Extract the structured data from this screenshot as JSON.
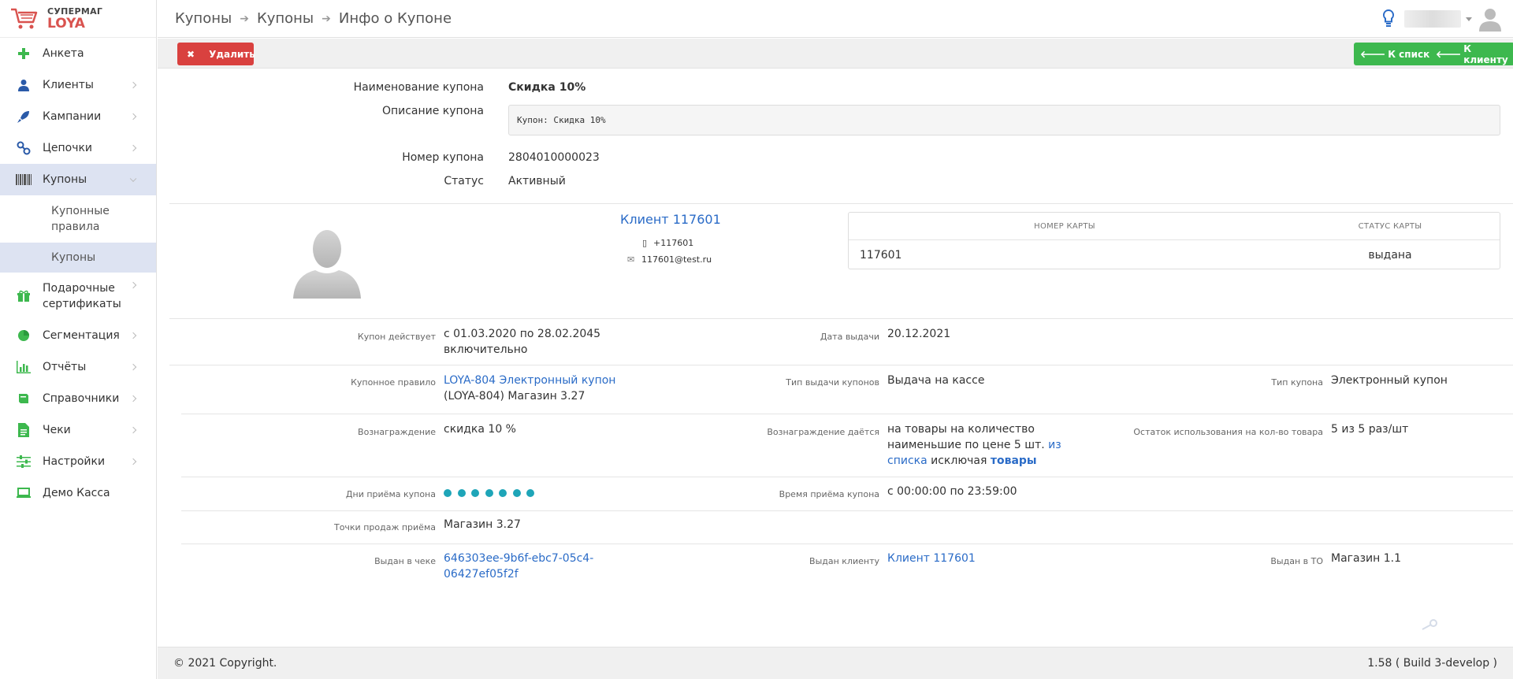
{
  "logo": {
    "line1": "СУПЕРМАГ",
    "line2": "LOYA"
  },
  "sidebar": {
    "items": [
      {
        "label": "Анкета",
        "icon": "plus-icon"
      },
      {
        "label": "Клиенты",
        "icon": "user-icon"
      },
      {
        "label": "Кампании",
        "icon": "rocket-icon"
      },
      {
        "label": "Цепочки",
        "icon": "chain-icon"
      },
      {
        "label": "Купоны",
        "icon": "barcode-icon"
      },
      {
        "label": "Подарочные сертификаты",
        "icon": "gift-icon"
      },
      {
        "label": "Сегментация",
        "icon": "pie-icon"
      },
      {
        "label": "Отчёты",
        "icon": "bar-chart-icon"
      },
      {
        "label": "Справочники",
        "icon": "book-icon"
      },
      {
        "label": "Чеки",
        "icon": "receipt-icon"
      },
      {
        "label": "Настройки",
        "icon": "sliders-icon"
      },
      {
        "label": "Демо Касса",
        "icon": "laptop-icon"
      }
    ],
    "sub": [
      {
        "label": "Купонные правила"
      },
      {
        "label": "Купоны"
      }
    ]
  },
  "breadcrumb": [
    "Купоны",
    "Купоны",
    "Инфо о Купоне"
  ],
  "toolbar": {
    "delete_label": "Удалить",
    "to_list_label": "К списку",
    "to_client_label": "К клиенту"
  },
  "coupon": {
    "name_label": "Наименование купона",
    "name": "Скидка 10%",
    "desc_label": "Описание купона",
    "desc": "Купон: Скидка 10%",
    "number_label": "Номер купона",
    "number": "2804010000023",
    "status_label": "Статус",
    "status": "Активный"
  },
  "client": {
    "name": "Клиент 117601",
    "phone": "+117601",
    "email": "117601@test.ru",
    "table": {
      "headers": [
        "НОМЕР КАРТЫ",
        "СТАТУС КАРТЫ"
      ],
      "rows": [
        [
          "117601",
          "выдана"
        ]
      ]
    }
  },
  "details": {
    "valid_label": "Купон действует",
    "valid_1": "с 01.03.2020 по 28.02.2045",
    "valid_2": "включительно",
    "issued_date_label": "Дата выдачи",
    "issued_date": "20.12.2021",
    "rule_label": "Купонное правило",
    "rule_link": "LOYA-804 Электронный купон",
    "rule_2": "(LOYA-804) Магазин 3.27",
    "issue_type_label": "Тип выдачи купонов",
    "issue_type": "Выдача на кассе",
    "coupon_type_label": "Тип купона",
    "coupon_type": "Электронный купон",
    "reward_label": "Вознаграждение",
    "reward": "скидка 10 %",
    "reward_given_label": "Вознаграждение даётся",
    "reward_given_1": "на товары на количество",
    "reward_given_2": "наименьшие по цене 5 шт.",
    "reward_given_2_link": "из",
    "reward_given_3_link": "списка",
    "reward_given_3": "исключая",
    "reward_given_3_bold": "товары",
    "remaining_label": "Остаток использования на кол-во товара",
    "remaining": "5 из 5 раз/шт",
    "days_label": "Дни приёма купона",
    "days_count": 7,
    "time_label": "Время приёма купона",
    "time": "с 00:00:00 по 23:59:00",
    "points_label": "Точки продаж приёма",
    "points": "Магазин 3.27",
    "receipt_label": "Выдан в чеке",
    "receipt_1": "646303ee-9b6f-ebc7-05c4-",
    "receipt_2": "06427ef05f2f",
    "issued_client_label": "Выдан клиенту",
    "issued_client": "Клиент 117601",
    "issued_to_label": "Выдан в ТО",
    "issued_to": "Магазин 1.1"
  },
  "footer": {
    "copyright": "© 2021 Copyright.",
    "version": "1.58 ( Build 3-develop )"
  },
  "colors": {
    "accent": "#2a6bc7",
    "danger": "#d9413f",
    "success": "#3db84e",
    "dot": "#1ea5b8",
    "active_menu": "#dde3f2"
  }
}
